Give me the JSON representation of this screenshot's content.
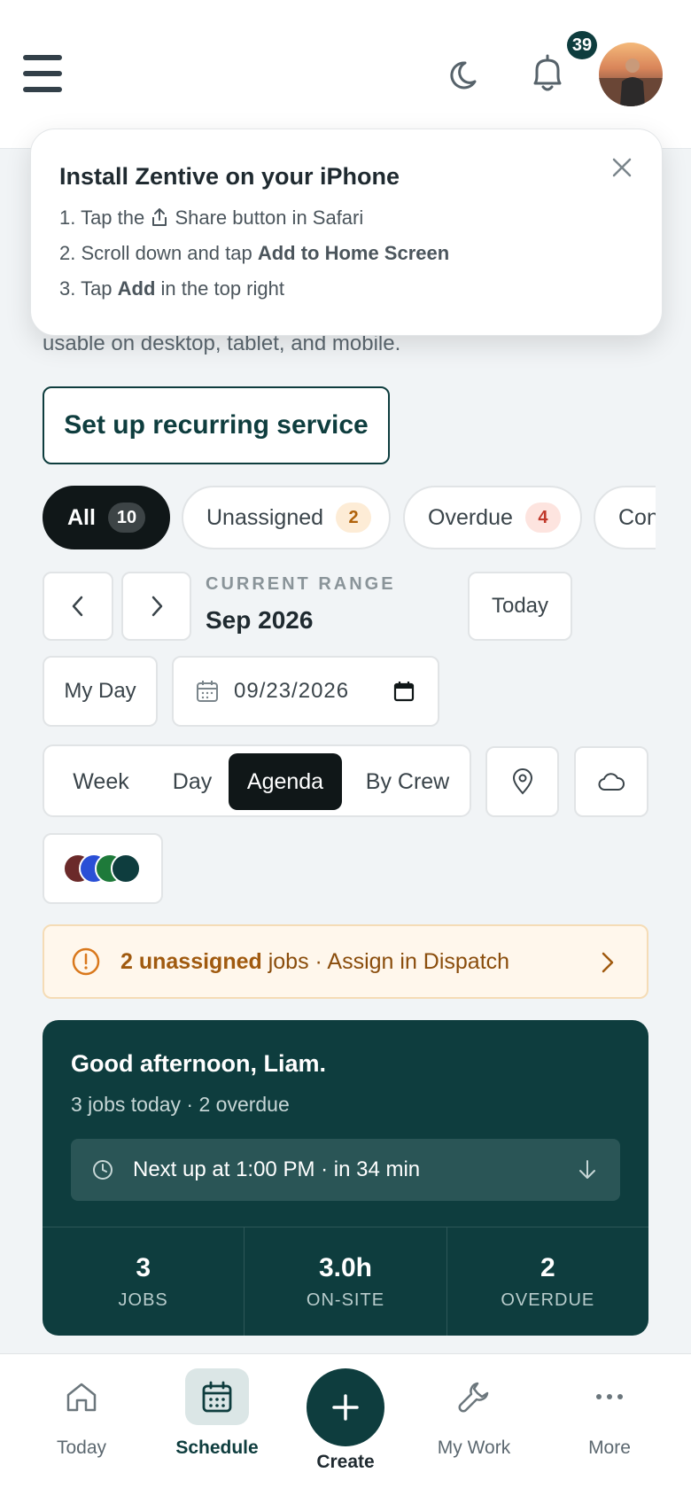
{
  "header": {
    "notification_count": "39",
    "icons": [
      "menu-icon",
      "moon-icon",
      "bell-icon",
      "avatar"
    ]
  },
  "intro": {
    "text_tail": "usable on desktop, tablet, and mobile."
  },
  "install_prompt": {
    "title": "Install Zentive on your iPhone",
    "step1_a": "1. Tap the ",
    "step1_b": " Share button in Safari",
    "step2_a": "2. Scroll down and tap ",
    "step2_b": "Add to Home Screen",
    "step3_a": "3. Tap ",
    "step3_b": "Add",
    "step3_c": " in the top right"
  },
  "recurring_button": "Set up recurring service",
  "filters": [
    {
      "label": "All",
      "count": "10"
    },
    {
      "label": "Unassigned",
      "count": "2"
    },
    {
      "label": "Overdue",
      "count": "4"
    },
    {
      "label": "Con",
      "count": ""
    }
  ],
  "range": {
    "label": "CURRENT RANGE",
    "value": "Sep 2026",
    "today_button": "Today"
  },
  "my_day_button": "My Day",
  "date_input": "09/23/2026",
  "view_tabs": [
    "Week",
    "Day",
    "Agenda",
    "By Crew"
  ],
  "active_view": "Agenda",
  "crew_colors": [
    "#6b2a2a",
    "#2a4fd6",
    "#1e7a3a",
    "#0e3d3e"
  ],
  "alert": {
    "bold": "2 unassigned",
    "text": " jobs · Assign in Dispatch"
  },
  "hero": {
    "greeting": "Good afternoon, Liam.",
    "summary": "3 jobs today · 2 overdue",
    "next_up": "Next up at 1:00 PM · in 34 min",
    "stats": [
      {
        "value": "3",
        "label": "JOBS"
      },
      {
        "value": "3.0h",
        "label": "ON-SITE"
      },
      {
        "value": "2",
        "label": "OVERDUE"
      }
    ]
  },
  "bottom_nav": {
    "today": "Today",
    "schedule": "Schedule",
    "create": "Create",
    "my_work": "My Work",
    "more": "More"
  },
  "colors": {
    "brand": "#0e3d3e",
    "dark": "#101718",
    "warning_bg": "#fff7ec"
  }
}
